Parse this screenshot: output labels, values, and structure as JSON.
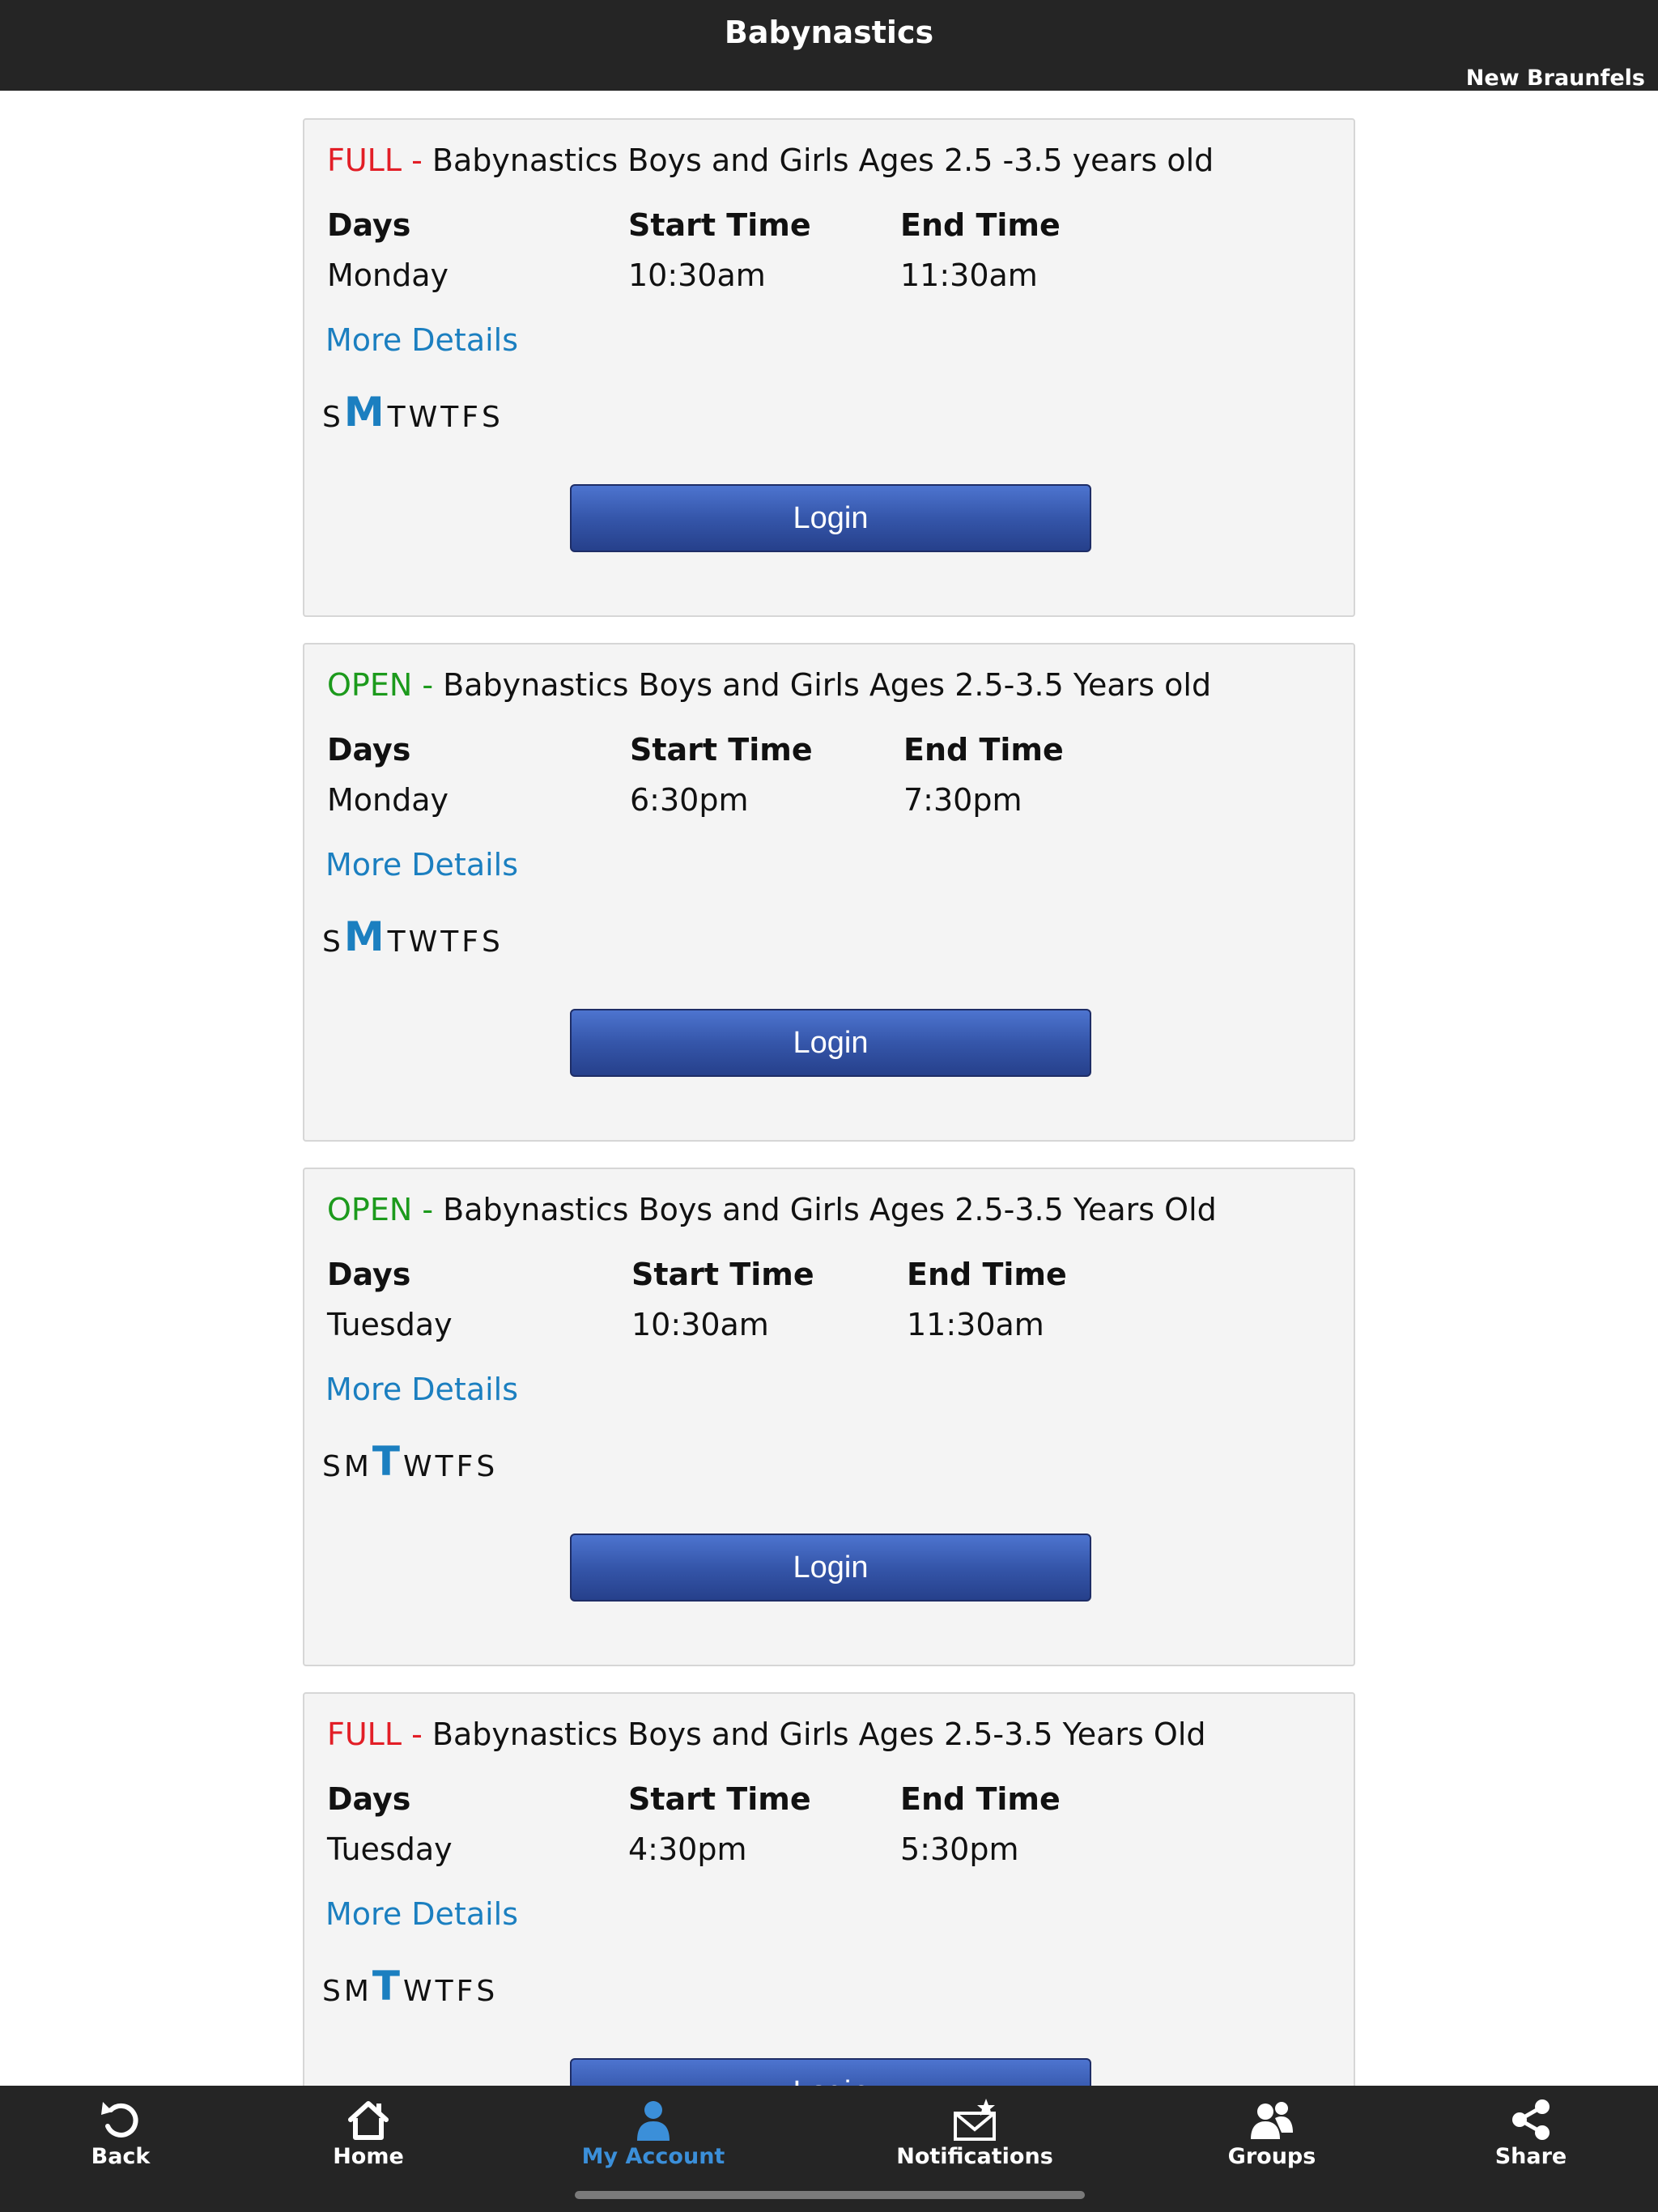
{
  "header": {
    "title": "Babynastics",
    "location": "New Braunfels"
  },
  "columns": {
    "days": "Days",
    "start": "Start Time",
    "end": "End Time"
  },
  "more_details_label": "More Details",
  "login_label": "Login",
  "colors": {
    "full": "#e21e26",
    "open": "#1c9a1c",
    "link": "#1b7fc0",
    "button": "#3556aa",
    "active_tab": "#3b8fd9"
  },
  "classes": [
    {
      "status": "FULL - ",
      "status_type": "full",
      "title": "Babynastics Boys and Girls Ages 2.5 -3.5 years old",
      "day": "Monday",
      "start": "10:30am",
      "end": "11:30am",
      "active_day_index": 1
    },
    {
      "status": "OPEN - ",
      "status_type": "open",
      "title": "Babynastics Boys and Girls Ages 2.5-3.5 Years old",
      "day": "Monday",
      "start": "6:30pm",
      "end": "7:30pm",
      "active_day_index": 1
    },
    {
      "status": "OPEN - ",
      "status_type": "open",
      "title": "Babynastics Boys and Girls Ages 2.5-3.5 Years Old",
      "day": "Tuesday",
      "start": "10:30am",
      "end": "11:30am",
      "active_day_index": 2
    },
    {
      "status": "FULL - ",
      "status_type": "full",
      "title": "Babynastics Boys and Girls Ages 2.5-3.5 Years Old",
      "day": "Tuesday",
      "start": "4:30pm",
      "end": "5:30pm",
      "active_day_index": 2
    }
  ],
  "weekdays": [
    "S",
    "M",
    "T",
    "W",
    "T",
    "F",
    "S"
  ],
  "tabs": [
    {
      "label": "Back",
      "icon": "back-icon"
    },
    {
      "label": "Home",
      "icon": "home-icon"
    },
    {
      "label": "My Account",
      "icon": "account-icon",
      "active": true
    },
    {
      "label": "Notifications",
      "icon": "notifications-icon"
    },
    {
      "label": "Groups",
      "icon": "groups-icon"
    },
    {
      "label": "Share",
      "icon": "share-icon"
    }
  ]
}
